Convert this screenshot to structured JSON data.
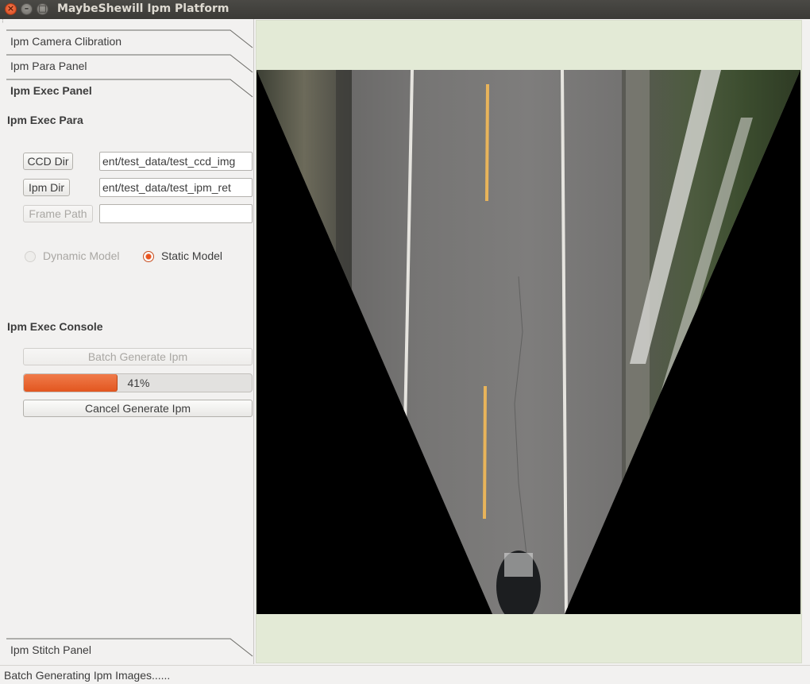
{
  "window": {
    "title": "MaybeShewill Ipm Platform",
    "close_glyph": "×",
    "min_glyph": "–",
    "max_glyph": "□"
  },
  "tabs": [
    {
      "label": "Ipm Camera Clibration",
      "active": false
    },
    {
      "label": "Ipm Para Panel",
      "active": false
    },
    {
      "label": "Ipm Exec Panel",
      "active": true
    },
    {
      "label": "Ipm Stitch Panel",
      "active": false
    }
  ],
  "exec_para": {
    "title": "Ipm Exec Para",
    "ccd_dir_button": "CCD Dir",
    "ccd_dir_value": "ent/test_data/test_ccd_img",
    "ipm_dir_button": "Ipm Dir",
    "ipm_dir_value": "ent/test_data/test_ipm_ret",
    "frame_path_button": "Frame Path",
    "frame_path_value": "",
    "model_options": [
      {
        "label": "Dynamic Model",
        "checked": false,
        "enabled": false
      },
      {
        "label": "Static Model",
        "checked": true,
        "enabled": true
      }
    ]
  },
  "exec_console": {
    "title": "Ipm Exec Console",
    "batch_button": "Batch Generate Ipm",
    "progress_percent": 41,
    "progress_text": "41%",
    "cancel_button": "Cancel Generate Ipm"
  },
  "status": {
    "message": "Batch Generating Ipm Images......"
  },
  "colors": {
    "accent": "#e95420",
    "viewer_bg": "#e3ead6",
    "road": "#6d6c6b",
    "lane_yellow": "#e8b45a",
    "lane_white": "#e6e4df"
  }
}
